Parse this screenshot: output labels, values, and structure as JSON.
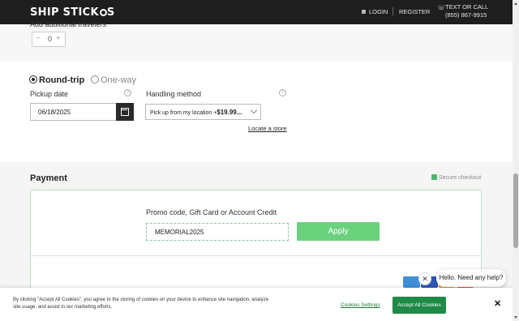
{
  "header": {
    "logo": "SHIP STICK",
    "login": "LOGIN",
    "register": "REGISTER",
    "contact_line1": "TEXT OR CALL",
    "contact_line2": "(855) 867-9915"
  },
  "top_section": {
    "cut_label": "Add additional travelers",
    "stepper_value": "0"
  },
  "trip": {
    "round_trip_label": "Round-trip",
    "one_way_label": "One-way",
    "selected": "Round-trip",
    "pickup_label": "Pickup date",
    "pickup_value": "06/18/2025",
    "handling_label": "Handling method",
    "handling_value_prefix": "Pick up from my location +",
    "handling_value_price": "$19.99...",
    "locate_link": "Locate a store"
  },
  "payment": {
    "title": "Payment",
    "secure": "Secure checkout",
    "promo_label": "Promo code, Gift Card or Account Credit",
    "promo_value": "MEMORIAL2025",
    "apply_label": "Apply"
  },
  "chat": {
    "bubble": "Hello. Need any help?",
    "close": "✕"
  },
  "cookie": {
    "text": "By clicking \"Accept All Cookies\", you agree to the storing of cookies on your device to enhance site navigation, analyze site usage, and assist in our marketing efforts.",
    "settings": "Cookies Settings",
    "accept": "Accept All Cookies",
    "close": "✕"
  },
  "colors": {
    "header_bg": "#1e1e1e",
    "accent_green": "#6ad17d",
    "accept_green": "#1f8a45"
  }
}
